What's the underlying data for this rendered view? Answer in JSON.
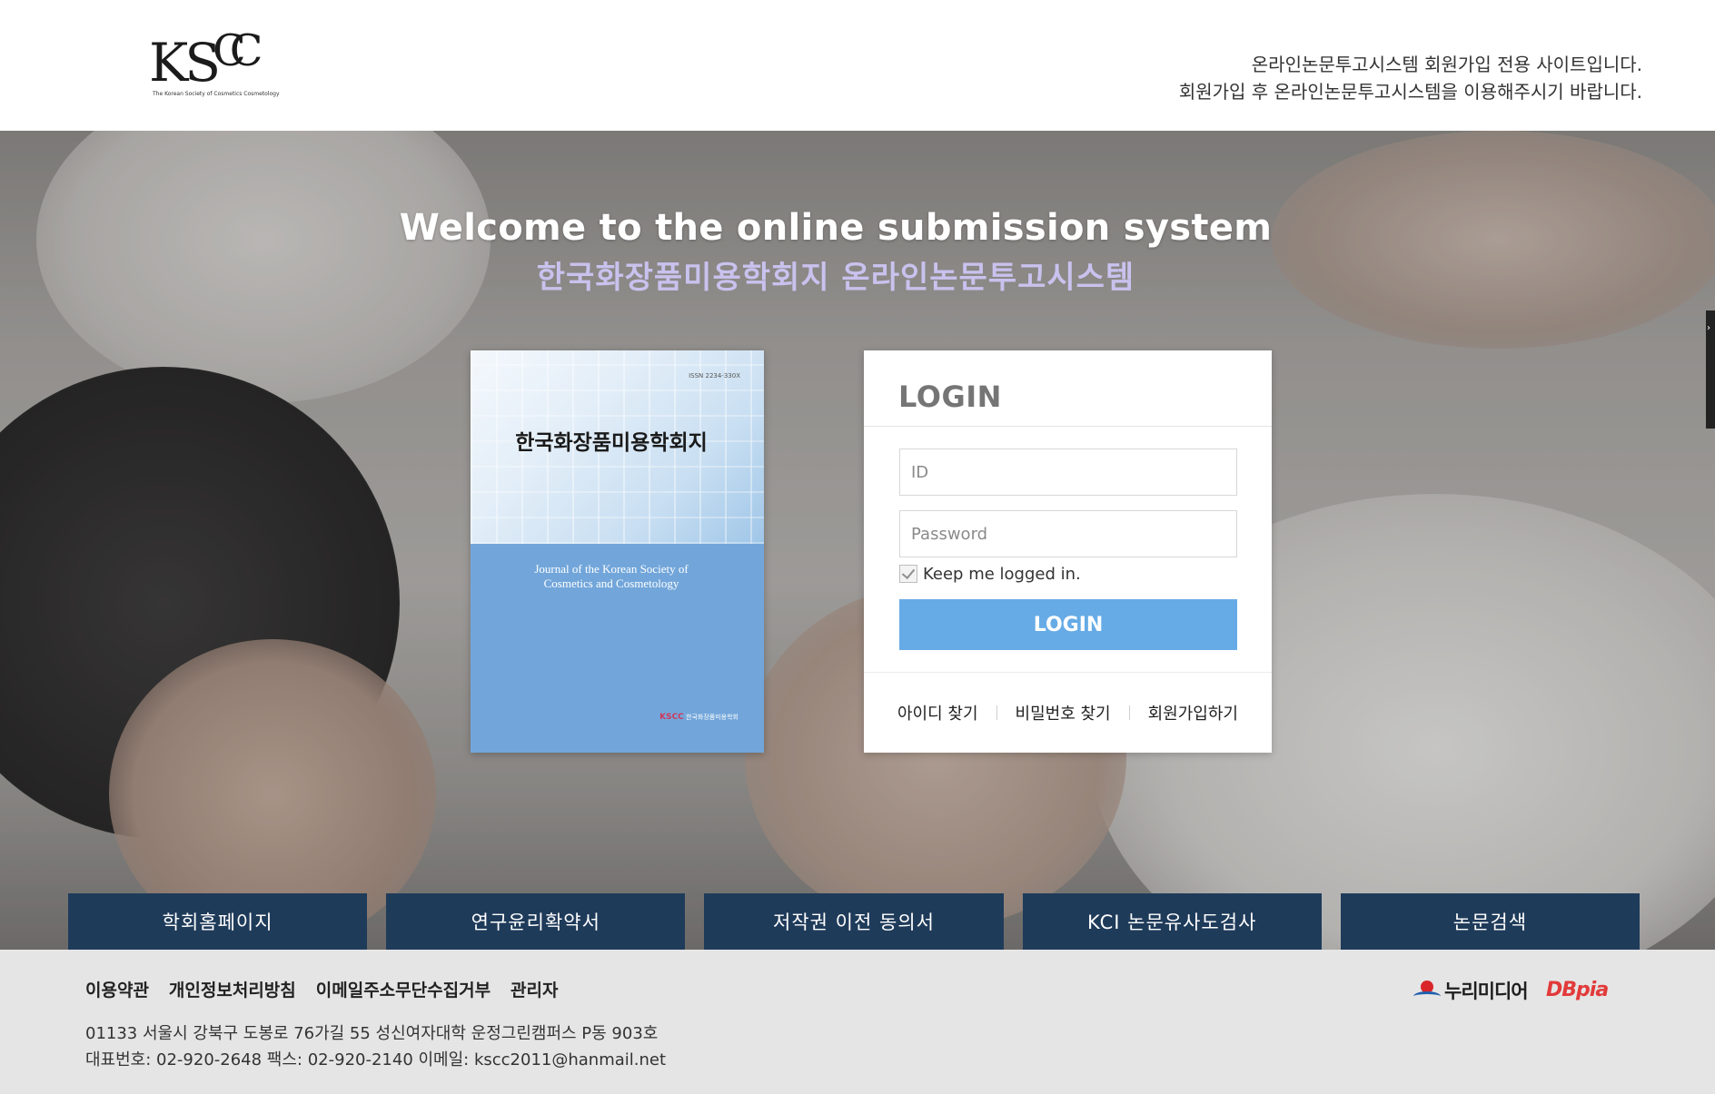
{
  "header": {
    "logo": {
      "letters": "KSCC",
      "subtitle": "The Korean Society of Cosmetics Cosmetology"
    },
    "notice_line1": "온라인논문투고시스템 회원가입 전용 사이트입니다.",
    "notice_line2": "회원가입 후 온라인논문투고시스템을 이용해주시기 바랍니다."
  },
  "hero": {
    "title_en": "Welcome to the online submission system",
    "title_ko": "한국화장품미용학회지 온라인논문투고시스템"
  },
  "journal_cover": {
    "issn": "ISSN 2234-330X",
    "title_ko": "한국화장품미용학회지",
    "title_en_line1": "Journal of the Korean Society of",
    "title_en_line2": "Cosmetics and Cosmetology",
    "publisher_mark": "KSCC",
    "publisher_name": "한국화장품미용학회"
  },
  "login": {
    "title": "LOGIN",
    "id_placeholder": "ID",
    "password_placeholder": "Password",
    "keep_logged_in_label": "Keep me logged in.",
    "keep_logged_in_checked": true,
    "button_label": "LOGIN",
    "links": {
      "find_id": "아이디 찾기",
      "find_password": "비밀번호 찾기",
      "signup": "회원가입하기"
    }
  },
  "quick_menu": [
    "학회홈페이지",
    "연구윤리확약서",
    "저작권 이전 동의서",
    "KCI 논문유사도검사",
    "논문검색"
  ],
  "footer": {
    "links": [
      "이용약관",
      "개인정보처리방침",
      "이메일주소무단수집거부",
      "관리자"
    ],
    "address": "01133 서울시 강북구 도봉로 76가길 55 성신여자대학 운정그린캠퍼스 P동 903호",
    "contact": "대표번호: 02-920-2648 팩스: 02-920-2140 이메일: kscc2011@hanmail.net",
    "partners": [
      "누리미디어",
      "DBpia"
    ]
  },
  "colors": {
    "login_button": "#66abe6",
    "quick_menu_bg": "#1f3b5a",
    "hero_title_ko": "#c9c2ee",
    "cover_blue": "#72a6da",
    "footer_bg": "#e5e5e5"
  },
  "icons": [
    "nurimedia-logo-icon",
    "checkbox-check-icon"
  ]
}
